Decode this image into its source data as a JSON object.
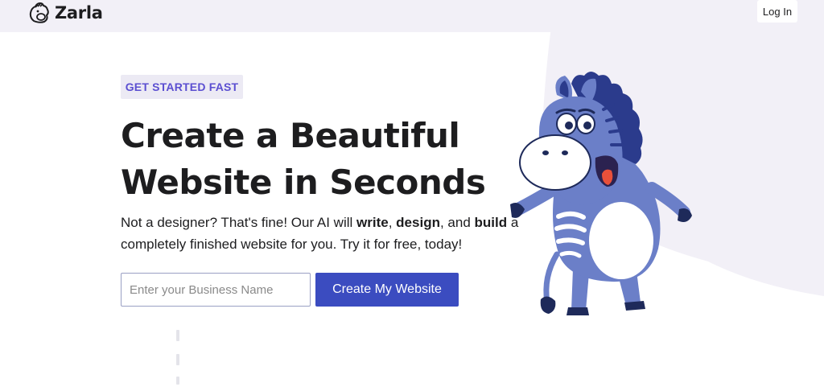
{
  "brand": {
    "name": "Zarla",
    "logo_icon": "zebra-logo-icon"
  },
  "header": {
    "login_label": "Log In"
  },
  "hero": {
    "badge": "GET STARTED FAST",
    "headline_line1": "Create a Beautiful",
    "headline_line2": "Website in Seconds",
    "description": {
      "part1": "Not a designer? That's fine! Our AI will ",
      "bold1": "write",
      "part2": ", ",
      "bold2": "design",
      "part3": ", and ",
      "bold3": "build",
      "part4": " a completely finished website for you. Try it for free, today!"
    },
    "input_placeholder": "Enter your Business Name",
    "input_value": "",
    "cta_label": "Create My Website",
    "illustration": "zebra-mascot-illustration"
  },
  "colors": {
    "accent": "#3b4cc0",
    "badge_text": "#5b4fd1",
    "badge_bg": "#eceaf4",
    "background_tint": "#f2f0f7",
    "mascot_body": "#6b7fc8"
  }
}
